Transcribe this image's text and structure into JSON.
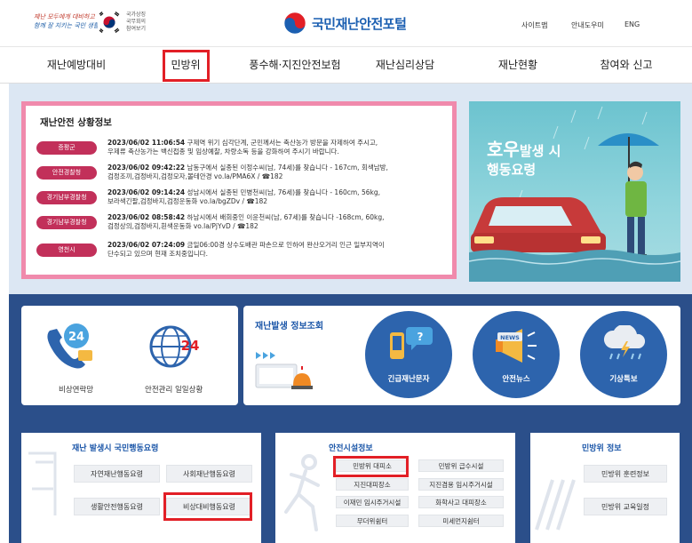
{
  "header": {
    "slogan_line1": "재난 모두에게 대비하고",
    "slogan_line2": "함께 잘 지키는 국민 생활",
    "sub_logo_line1": "국가상징",
    "sub_logo_line2": "국무회의",
    "sub_logo_line3": "참여보기",
    "site_title": "국민재난안전포털",
    "util_links": [
      "사이트맵",
      "안내도우미",
      "ENG"
    ]
  },
  "nav": {
    "items": [
      "재난예방대비",
      "민방위",
      "풍수해·지진안전보험",
      "재난심리상담",
      "재난현황",
      "참여와 신고"
    ]
  },
  "status": {
    "title": "재난안전 상황정보",
    "items": [
      {
        "badge": "증평군",
        "time": "2023/06/02 11:06:54",
        "line1": " 구제역 위기 심각단계, 군민께서는 축산농가 방문을 자제하여 주시고,",
        "line2": "우제류 축산농가는 백신접종 및 임상예찰, 차량소독 등을 강화하여 주시기 바랍니다."
      },
      {
        "badge": "안전경찰청",
        "time": "2023/06/02 09:42:22",
        "line1": " 남동구에서 실종된 이정수씨(남, 74세)를 찾습니다 - 167cm, 회색남방,",
        "line2": "검정조끼,검정바지,검정모자,볼테안경 vo.la/PMA6X / ☎182"
      },
      {
        "badge": "경기남부경찰청",
        "time": "2023/06/02 09:14:24",
        "line1": " 성남시에서 실종된 민병천씨(남, 76세)를 찾습니다 - 160cm, 56kg,",
        "line2": "보라색긴팔,검정바지,검정운동화 vo.la/bgZDv / ☎182"
      },
      {
        "badge": "경기남부경찰청",
        "time": "2023/06/02 08:58:42",
        "line1": " 하남시에서 배회중인 이윤천씨(남, 67세)를 찾습니다 -168cm, 60kg,",
        "line2": "검정상의,검정바지,흰색운동화 vo.la/PjYvD / ☎182"
      },
      {
        "badge": "영천시",
        "time": "2023/06/02 07:24:09",
        "line1": " 금일06:00경 상수도배관 파손으로 인하여 완산오거리 인근 일부지역이",
        "line2": "단수되고 있으며 현재 조치중입니다."
      }
    ]
  },
  "banner": {
    "title_bold": "호우",
    "title_rest": "발생 시",
    "subtitle": "행동요령"
  },
  "quick_links": {
    "emergency": "비상연락망",
    "safety_status": "안전관리 일일상황",
    "info_title": "재난발생 정보조회",
    "emergency_sms": "긴급재난문자",
    "safety_news": "안전뉴스",
    "weather_alert": "기상특보"
  },
  "action_guide": {
    "title": "재난 발생시 국민행동요령",
    "items": [
      "자연재난행동요령",
      "사회재난행동요령",
      "생활안전행동요령",
      "비상대비행동요령"
    ]
  },
  "facility": {
    "title": "안전시설정보",
    "items": [
      "민방위 대피소",
      "민방위 급수시설",
      "지진대피장소",
      "지진겸용 임시주거시설",
      "이재민 임시주거시설",
      "화학사고 대피장소",
      "무더위쉼터",
      "미세먼지쉼터"
    ]
  },
  "civil_defense": {
    "title": "민방위 정보",
    "items": [
      "민방위 훈련정보",
      "민방위 교육일정"
    ]
  },
  "colors": {
    "brand_blue": "#1b5fb1",
    "badge_red": "#c2305a",
    "highlight_red": "#e21f26",
    "section_navy": "#2b4f8a",
    "status_border_pink": "#f08aac"
  }
}
